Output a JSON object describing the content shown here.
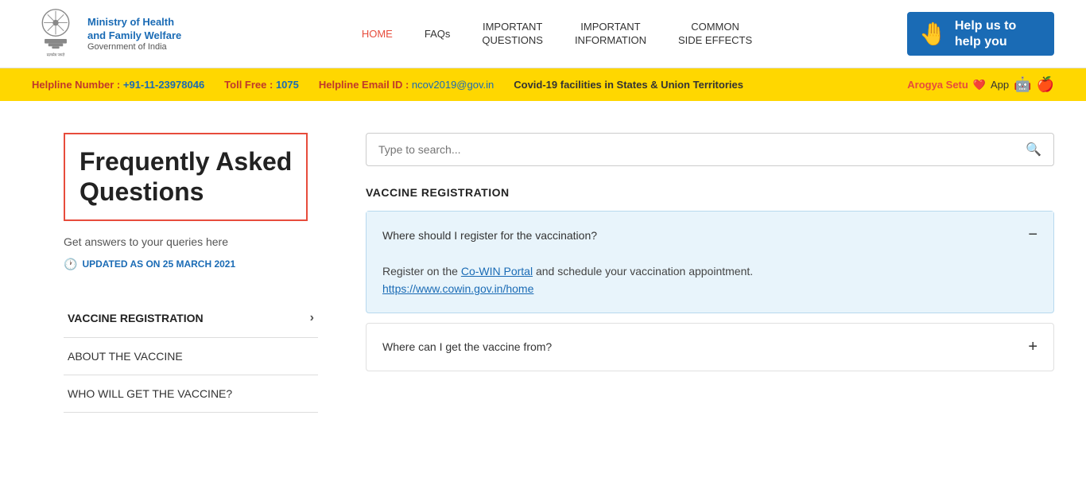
{
  "header": {
    "logo": {
      "ministry_line1": "Ministry of Health",
      "ministry_line2": "and Family Welfare",
      "govt": "Government of India",
      "slogan": "सत्यमेव जयते"
    },
    "nav": [
      {
        "id": "home",
        "label": "HOME",
        "active": false
      },
      {
        "id": "faqs",
        "label": "FAQs",
        "active": false
      },
      {
        "id": "important-questions",
        "label": "IMPORTANT\nQUESTIONS",
        "active": false
      },
      {
        "id": "important-information",
        "label": "IMPORTANT\nINFORMATION",
        "active": false
      },
      {
        "id": "common-side-effects",
        "label": "COMMON\nSIDE EFFECTS",
        "active": false
      }
    ],
    "help_banner": {
      "text": "Help us to\nhelp you"
    }
  },
  "info_bar": {
    "helpline_label": "Helpline Number :",
    "helpline_number": "+91-11-23978046",
    "toll_label": "Toll Free :",
    "toll_number": "1075",
    "email_label": "Helpline Email ID :",
    "email_value": "ncov2019@gov.in",
    "covid_facilities": "Covid-19 facilities in States & Union Territories",
    "arogya_label": "Arogya Setu",
    "app_label": "App"
  },
  "left_panel": {
    "title_line1": "Frequently Asked",
    "title_line2": "Questions",
    "subtitle": "Get answers to your queries here",
    "updated": "UPDATED AS ON 25 MARCH 2021",
    "menu_items": [
      {
        "id": "vaccine-registration",
        "label": "VACCINE REGISTRATION",
        "active": true,
        "has_arrow": true
      },
      {
        "id": "about-vaccine",
        "label": "ABOUT THE VACCINE",
        "active": false,
        "has_arrow": false
      },
      {
        "id": "who-will-get",
        "label": "WHO WILL GET THE VACCINE?",
        "active": false,
        "has_arrow": false
      }
    ]
  },
  "right_panel": {
    "search_placeholder": "Type to search...",
    "section_title": "VACCINE REGISTRATION",
    "faq_items": [
      {
        "id": "faq-1",
        "question": "Where should I register for the vaccination?",
        "expanded": true,
        "toggle_symbol": "−",
        "answer_text": "Register on the ",
        "answer_link_text": "Co-WIN Portal",
        "answer_link_url": "https://www.cowin.gov.in/home",
        "answer_after_link": " and schedule your vaccination appointment.",
        "answer_url_display": "https://www.cowin.gov.in/home"
      },
      {
        "id": "faq-2",
        "question": "Where can I get the vaccine from?",
        "expanded": false,
        "toggle_symbol": "+"
      }
    ]
  }
}
